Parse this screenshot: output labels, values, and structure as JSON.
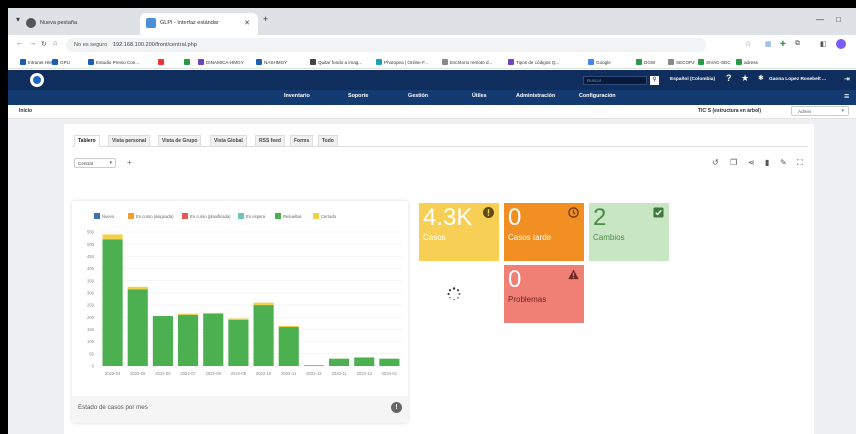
{
  "browser": {
    "tabs": [
      {
        "label": "Nueva pestaña"
      },
      {
        "label": "GLPI - Interfaz estándar"
      }
    ],
    "new_tab": "+",
    "url_security": "No es seguro",
    "url": "192.168.100.200/front/central.php",
    "bookmarks": [
      {
        "label": "Intranet HMGY",
        "color": "#1b5fb5"
      },
      {
        "label": "GPU",
        "color": "#1b5fb5"
      },
      {
        "label": "Estudio Previo Con...",
        "color": "#1b5fb5"
      },
      {
        "label": "",
        "color": "#e33"
      },
      {
        "label": "",
        "color": "#2a9a46"
      },
      {
        "label": "DINAMICA-HMGY",
        "color": "#6f42c1"
      },
      {
        "label": "NASHMGY",
        "color": "#1b5fb5"
      },
      {
        "label": "Quitar fondo a imag...",
        "color": "#444"
      },
      {
        "label": "Photopea | Online F...",
        "color": "#17a2b8"
      },
      {
        "label": "Escritorio remoto d...",
        "color": "#888"
      },
      {
        "label": "Tipos de códigos Q...",
        "color": "#6f42c1"
      },
      {
        "label": "Google",
        "color": "#4285f4"
      },
      {
        "label": "DGW",
        "color": "#2a9a46"
      },
      {
        "label": "SECOP2",
        "color": "#888"
      },
      {
        "label": "SIVAC-SDC",
        "color": "#2a9a46"
      },
      {
        "label": "adress",
        "color": "#2a9a46"
      }
    ]
  },
  "app": {
    "search_placeholder": "Buscar",
    "language": "Español (Colombia)",
    "help": "?",
    "user": "Gaona Lopez Rosebelt ...",
    "menu": [
      "Inventario",
      "Soporte",
      "Gestión",
      "Útiles",
      "Administración",
      "Configuración"
    ],
    "breadcrumb": "Inicio",
    "entity_label": "TIC´S (estructura en árbol)",
    "profile": "Admin"
  },
  "dashboard": {
    "tabs": [
      "Tablero",
      "Vista personal",
      "Vista de Grupo",
      "Vista Global",
      "RSS feed",
      "Forms",
      "Todo"
    ],
    "active_tab": 0,
    "selected": "Central",
    "add": "+",
    "chart_title": "Estado de casos por mes",
    "tiles": [
      {
        "value": "4.3K",
        "label": "Casos",
        "bg": "#f8cf55",
        "icon": "warning-icon"
      },
      {
        "value": "0",
        "label": "Casos tarde",
        "bg": "#f28f22",
        "icon": "clock-icon"
      },
      {
        "value": "2",
        "label": "Cambios",
        "bg": "#c8e6c3",
        "icon": "check-icon"
      },
      {
        "value": "0",
        "label": "Problemas",
        "bg": "#f07f75",
        "icon": "alert-triangle-icon"
      }
    ]
  },
  "chart_data": {
    "type": "bar",
    "stacked": true,
    "title": "Estado de casos por mes",
    "categories": [
      "2022-04",
      "2022-05",
      "2022-06",
      "2022-07",
      "2022-08",
      "2022-09",
      "2022-10",
      "2022-11",
      "2022-12",
      "2023-11",
      "2023-12",
      "2024-01"
    ],
    "ylim": [
      0,
      550
    ],
    "yticks": [
      0,
      50,
      100,
      150,
      200,
      250,
      300,
      350,
      400,
      450,
      500,
      550
    ],
    "legend_position": "top",
    "series": [
      {
        "name": "Nuevo",
        "color": "#3b6fb6",
        "values": [
          0,
          0,
          0,
          0,
          0,
          0,
          0,
          0,
          0,
          0,
          0,
          0
        ]
      },
      {
        "name": "En curso (asignada)",
        "color": "#f39c38",
        "values": [
          0,
          0,
          0,
          0,
          0,
          0,
          0,
          0,
          0,
          0,
          0,
          0
        ]
      },
      {
        "name": "En curso (planificada)",
        "color": "#e05a5a",
        "values": [
          0,
          0,
          0,
          0,
          0,
          0,
          0,
          0,
          0,
          0,
          0,
          0
        ]
      },
      {
        "name": "En espera",
        "color": "#6cc6b7",
        "values": [
          0,
          0,
          0,
          0,
          0,
          0,
          0,
          0,
          0,
          0,
          0,
          0
        ]
      },
      {
        "name": "Resueltas",
        "color": "#4caf50",
        "values": [
          520,
          315,
          205,
          210,
          215,
          190,
          250,
          160,
          3,
          30,
          35,
          30
        ]
      },
      {
        "name": "Cerrado",
        "color": "#f1d04b",
        "values": [
          20,
          10,
          0,
          5,
          3,
          5,
          10,
          5,
          0,
          0,
          0,
          0
        ]
      }
    ]
  }
}
